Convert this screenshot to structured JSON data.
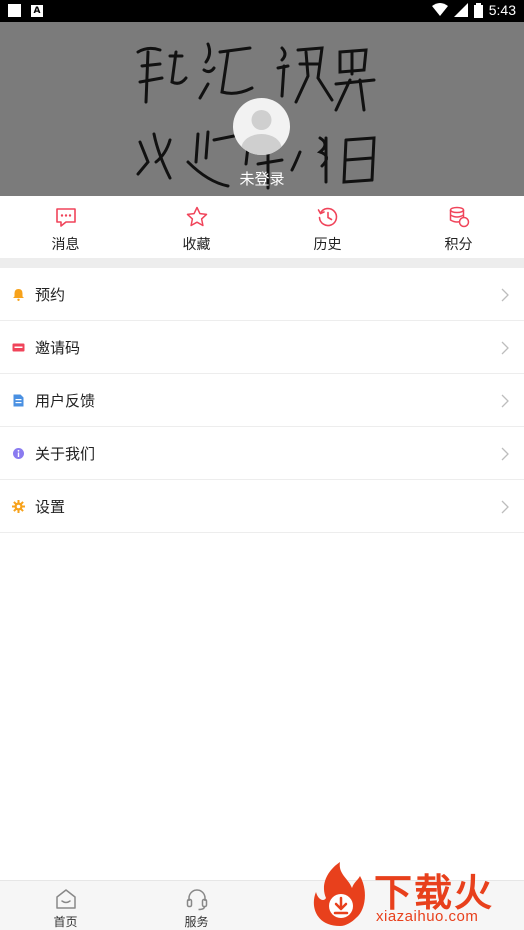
{
  "status_bar": {
    "time": "5:43",
    "notif_a": "A"
  },
  "header": {
    "login_text": "未登录"
  },
  "quick_nav": [
    {
      "label": "消息",
      "icon": "message-icon"
    },
    {
      "label": "收藏",
      "icon": "star-icon"
    },
    {
      "label": "历史",
      "icon": "history-icon"
    },
    {
      "label": "积分",
      "icon": "coins-icon"
    }
  ],
  "menu": [
    {
      "label": "预约",
      "icon": "bell-icon",
      "color": "#f7a21b"
    },
    {
      "label": "邀请码",
      "icon": "ticket-icon",
      "color": "#f0445a"
    },
    {
      "label": "用户反馈",
      "icon": "feedback-icon",
      "color": "#4a90e2"
    },
    {
      "label": "关于我们",
      "icon": "info-icon",
      "color": "#8a7bf0"
    },
    {
      "label": "设置",
      "icon": "gear-icon",
      "color": "#f7a21b"
    }
  ],
  "tabbar": [
    {
      "label": "首页",
      "icon": "home-icon"
    },
    {
      "label": "服务",
      "icon": "headset-icon"
    }
  ],
  "watermark": {
    "text": "下载火",
    "url": "xiazaihuo.com"
  },
  "colors": {
    "accent": "#f0445a",
    "header_bg": "#7b7b7b"
  }
}
